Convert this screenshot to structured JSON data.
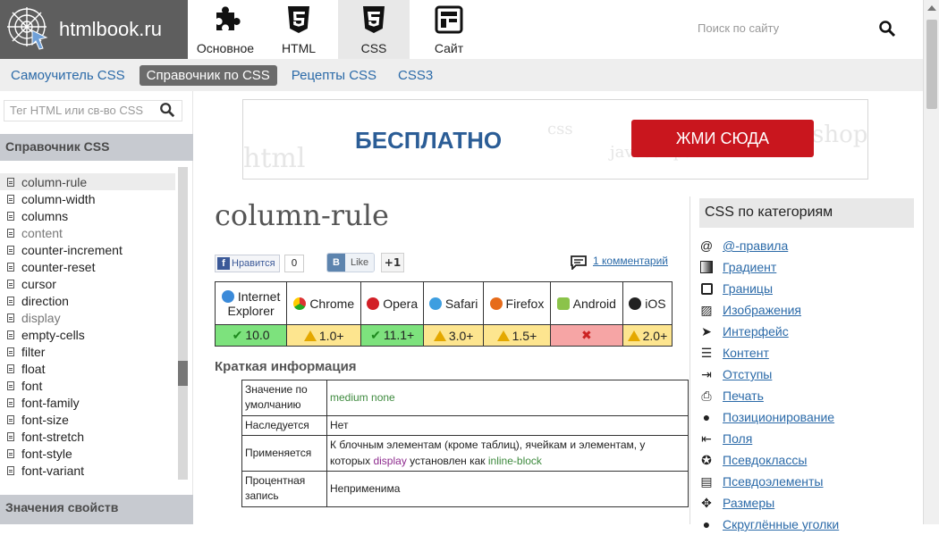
{
  "logo": {
    "text": "htmlbook.ru"
  },
  "topnav": [
    {
      "label": "Основное",
      "icon": "puzzle-icon"
    },
    {
      "label": "HTML",
      "icon": "html5-icon"
    },
    {
      "label": "CSS",
      "icon": "css3-icon",
      "active": true
    },
    {
      "label": "Сайт",
      "icon": "layout-icon"
    }
  ],
  "site_search": {
    "placeholder": "Поиск по сайту"
  },
  "subnav": [
    {
      "label": "Самоучитель CSS"
    },
    {
      "label": "Справочник по CSS",
      "active": true
    },
    {
      "label": "Рецепты CSS"
    },
    {
      "label": "CSS3"
    }
  ],
  "sidebar": {
    "search_placeholder": "Тег HTML или св-во CSS",
    "heading": "Справочник CSS",
    "items": [
      "column-rule",
      "column-width",
      "columns",
      "content",
      "counter-increment",
      "counter-reset",
      "cursor",
      "direction",
      "display",
      "empty-cells",
      "filter",
      "float",
      "font",
      "font-family",
      "font-size",
      "font-stretch",
      "font-style",
      "font-variant"
    ],
    "bottom_heading": "Значения свойств"
  },
  "banner": {
    "left_text": "БЕСПЛАТНО",
    "button": "ЖМИ СЮДА"
  },
  "page_title": "column-rule",
  "social": {
    "fb_label": "Нравится",
    "fb_count": "0",
    "vk_label": "Like",
    "gplus": "+1",
    "comments": "1 комментарий"
  },
  "browsers": {
    "names": [
      [
        "Internet",
        "Explorer"
      ],
      [
        "Chrome"
      ],
      [
        "Opera"
      ],
      [
        "Safari"
      ],
      [
        "Firefox"
      ],
      [
        "Android"
      ],
      [
        "iOS"
      ]
    ],
    "values": [
      "10.0",
      "1.0+",
      "11.1+",
      "3.0+",
      "1.5+",
      "",
      "2.0+"
    ],
    "status": [
      "ok",
      "warn",
      "ok",
      "warn",
      "warn",
      "bad",
      "warn"
    ]
  },
  "info": {
    "title": "Краткая информация",
    "rows": [
      {
        "key": "Значение по умолчанию",
        "value": "medium none"
      },
      {
        "key": "Наследуется",
        "value": "Нет"
      },
      {
        "key": "Применяется",
        "value_prefix": "К блочным элементам (кроме таблиц), ячейкам и элементам, у которых ",
        "value_code1": "display",
        "value_mid": " установлен как ",
        "value_code2": "inline-block"
      },
      {
        "key": "Процентная запись",
        "value": "Неприменима"
      }
    ]
  },
  "categories": {
    "heading": "CSS по категориям",
    "items": [
      {
        "label": "@-правила",
        "icon": "at-icon"
      },
      {
        "label": "Градиент",
        "icon": "gradient-icon"
      },
      {
        "label": "Границы",
        "icon": "border-icon"
      },
      {
        "label": "Изображения",
        "icon": "image-icon"
      },
      {
        "label": "Интерфейс",
        "icon": "cursor-icon"
      },
      {
        "label": "Контент",
        "icon": "list-icon"
      },
      {
        "label": "Отступы",
        "icon": "indent-icon"
      },
      {
        "label": "Печать",
        "icon": "printer-icon"
      },
      {
        "label": "Позиционирование",
        "icon": "pin-icon"
      },
      {
        "label": "Поля",
        "icon": "margin-icon"
      },
      {
        "label": "Псевдоклассы",
        "icon": "bulb-icon"
      },
      {
        "label": "Псевдоэлементы",
        "icon": "pseudo-icon"
      },
      {
        "label": "Размеры",
        "icon": "resize-icon"
      },
      {
        "label": "Скруглённые уголки",
        "icon": "rounded-icon"
      }
    ]
  }
}
